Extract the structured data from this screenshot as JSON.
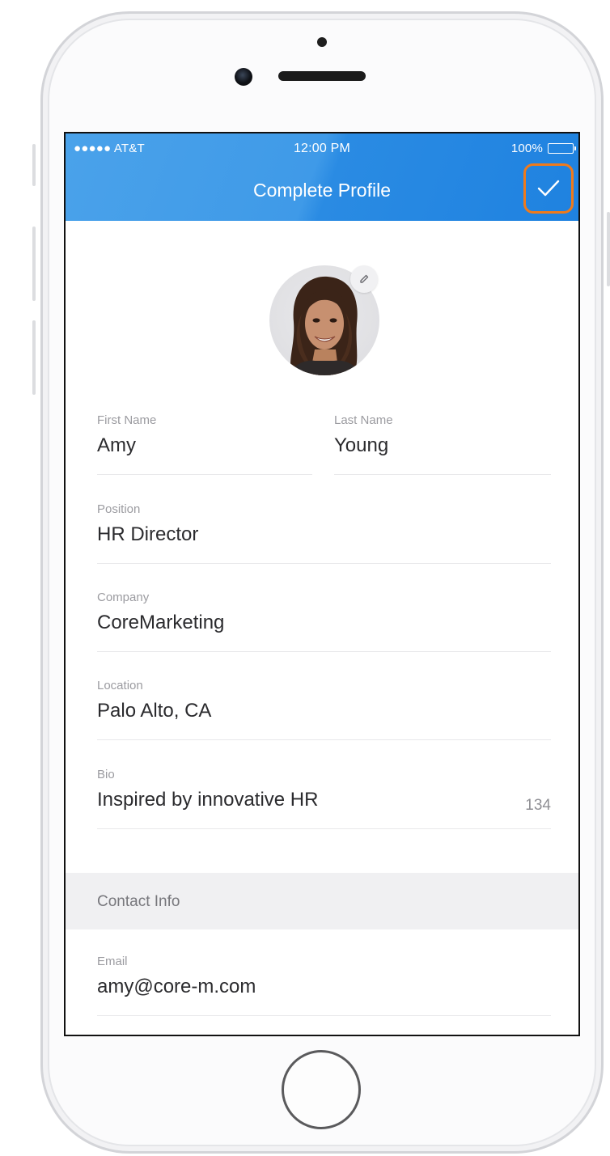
{
  "status_bar": {
    "carrier": "●●●●● AT&T",
    "time": "12:00 PM",
    "battery": "100%"
  },
  "nav": {
    "title": "Complete Profile",
    "confirm_icon": "checkmark-icon",
    "confirm_highlight_color": "#f07a1a"
  },
  "avatar": {
    "description_icon": "profile-photo",
    "edit_icon": "pencil-icon"
  },
  "form": {
    "first_name": {
      "label": "First Name",
      "value": "Amy"
    },
    "last_name": {
      "label": "Last Name",
      "value": "Young"
    },
    "position": {
      "label": "Position",
      "value": "HR Director"
    },
    "company": {
      "label": "Company",
      "value": "CoreMarketing"
    },
    "location": {
      "label": "Location",
      "value": "Palo Alto, CA"
    },
    "bio": {
      "label": "Bio",
      "value": "Inspired by innovative HR",
      "counter": "134"
    }
  },
  "contact": {
    "section_title": "Contact Info",
    "email": {
      "label": "Email",
      "value": "amy@core-m.com"
    }
  },
  "colors": {
    "accent_blue": "#2a8be3",
    "highlight_orange": "#f07a1a"
  }
}
